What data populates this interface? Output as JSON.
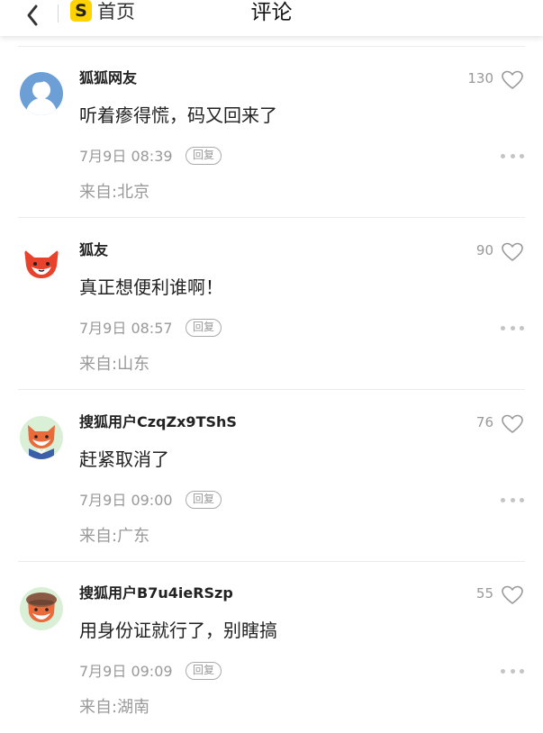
{
  "header": {
    "back_icon": "chevron-left-icon",
    "logo_letter": "S",
    "home_label": "首页",
    "title": "评论"
  },
  "colors": {
    "logo_bg": "#ffd200",
    "text_primary": "#222222",
    "text_secondary": "#999999"
  },
  "comments": [
    {
      "user": "狐狐网友",
      "likes": "130",
      "content": "听着瘆得慌，码又回来了",
      "time": "7月9日 08:39",
      "reply_label": "回复",
      "location": "来自:北京",
      "avatar": "default-user-avatar-icon"
    },
    {
      "user": "狐友",
      "likes": "90",
      "content": "真正想便利谁啊！",
      "time": "7月9日 08:57",
      "reply_label": "回复",
      "location": "来自:山东",
      "avatar": "red-fox-avatar-icon"
    },
    {
      "user": "搜狐用户CzqZx9TShS",
      "likes": "76",
      "content": "赶紧取消了",
      "time": "7月9日 09:00",
      "reply_label": "回复",
      "location": "来自:广东",
      "avatar": "fox-sailor-avatar-icon"
    },
    {
      "user": "搜狐用户B7u4ieRSzp",
      "likes": "55",
      "content": "用身份证就行了，别瞎搞",
      "time": "7月9日 09:09",
      "reply_label": "回复",
      "location": "来自:湖南",
      "avatar": "fox-beret-avatar-icon"
    }
  ]
}
